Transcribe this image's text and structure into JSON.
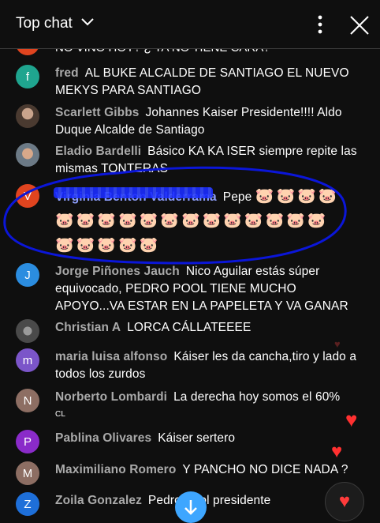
{
  "header": {
    "title": "Top chat",
    "icons": [
      "chevron-down-icon",
      "more-vert-icon",
      "close-icon"
    ]
  },
  "cut_message": "NO VINO HOY? ¿ YA NO TIENE CARA?",
  "messages": [
    {
      "author": "fred",
      "text": "AL BUKE ALCALDE DE SANTIAGO EL NUEVO MEKYS PARA SANTIAGO",
      "avatar_letter": "f",
      "avatar_color": "#1fa58f"
    },
    {
      "author": "Scarlett Gibbs",
      "text": "Johannes Kaiser Presidente!!!! Aldo Duque Alcalde de Santiago",
      "avatar_letter": "",
      "avatar_color": "#6b5a4e"
    },
    {
      "author": "Eladio Bardelli",
      "text": "Básico KA KA ISER siempre repite las mismas TONTERAS",
      "avatar_letter": "",
      "avatar_color": "#8a6b52"
    },
    {
      "author": "Virginia Benton Valderrama",
      "text": "Pepe",
      "avatar_letter": "V",
      "avatar_color": "#e0441f"
    },
    {
      "author": "Jorge Piñones Jauch",
      "text": "Nico Aguilar estás súper equivocado, PEDRO POOL TIENE MUCHO APOYO...VA ESTAR EN LA PAPELETA Y VA GANAR",
      "avatar_letter": "J",
      "avatar_color": "#2b8de0"
    },
    {
      "author": "Christian A",
      "text": "LORCA CÁLLATEEEE",
      "avatar_letter": "",
      "avatar_color": "#6c6c6c"
    },
    {
      "author": "maria luisa alfonso",
      "text": "Káiser les da cancha,tiro y lado a todos los zurdos",
      "avatar_letter": "m",
      "avatar_color": "#7b55c9"
    },
    {
      "author": "Norberto Lombardi",
      "text": "La derecha hoy somos el 60%",
      "avatar_letter": "N",
      "avatar_color": "#8d6e63"
    },
    {
      "author": "Pablina Olivares",
      "text": "Káiser sertero",
      "avatar_letter": "P",
      "avatar_color": "#8a2bc9"
    },
    {
      "author": "Maximiliano Romero",
      "text": "Y PANCHO NO DICE NADA ?",
      "avatar_letter": "M",
      "avatar_color": "#8d6e63"
    },
    {
      "author": "Zoila Gonzalez",
      "text": "Pedro Pool presidente",
      "avatar_letter": "Z",
      "avatar_color": "#1e6fd9"
    }
  ],
  "pig_emoji": "🐷",
  "small_cl": "CL",
  "colors": {
    "annotation": "#0b16d9",
    "accent": "#3ea6ff",
    "heart": "#ff3030"
  }
}
